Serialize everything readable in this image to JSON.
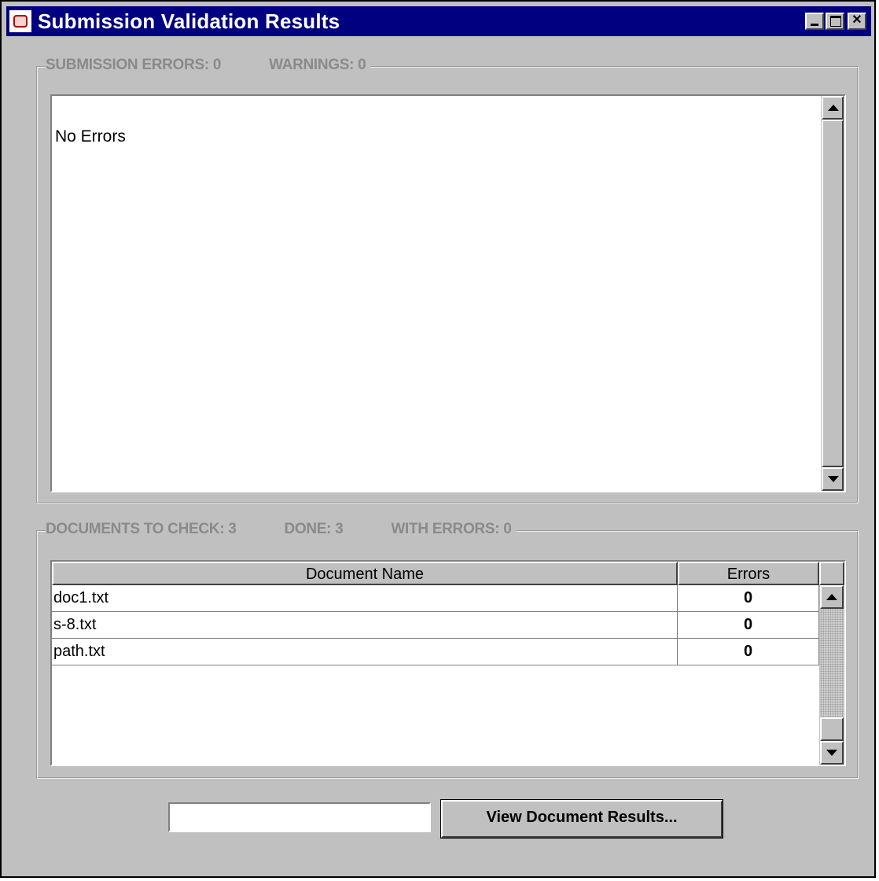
{
  "window": {
    "title": "Submission Validation Results",
    "icon": "java-cup-icon"
  },
  "submission_group": {
    "errors_label": "SUBMISSION ERRORS: 0",
    "warnings_label": "WARNINGS: 0",
    "text": "No Errors"
  },
  "documents_group": {
    "to_check_label": "DOCUMENTS TO CHECK: 3",
    "done_label": "DONE: 3",
    "with_errors_label": "WITH ERRORS: 0",
    "columns": [
      "Document Name",
      "Errors"
    ],
    "rows": [
      {
        "name": "doc1.txt",
        "errors": "0"
      },
      {
        "name": "s-8.txt",
        "errors": "0"
      },
      {
        "name": "path.txt",
        "errors": "0"
      }
    ]
  },
  "footer": {
    "input_value": "",
    "view_button_label": "View Document Results..."
  }
}
